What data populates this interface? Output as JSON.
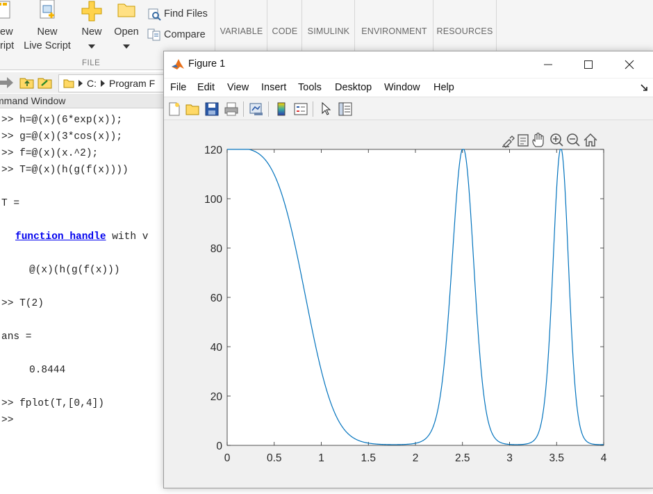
{
  "toolstrip": {
    "new_label_partial": [
      "ew",
      "ript"
    ],
    "new_live_script": [
      "New",
      "Live Script"
    ],
    "new": "New",
    "open": "Open",
    "find_files": "Find Files",
    "compare": "Compare",
    "section_file": "FILE",
    "tabs": [
      "VARIABLE",
      "CODE",
      "SIMULINK",
      "ENVIRONMENT",
      "RESOURCES"
    ]
  },
  "address": {
    "drive": "C:",
    "folder": "Program F"
  },
  "command_window": {
    "title": "mmand Window",
    "lines": [
      ">> h=@(x)(6*exp(x));",
      ">> g=@(x)(3*cos(x));",
      ">> f=@(x)(x.^2);",
      ">> T=@(x)(h(g(f(x))))",
      "T =",
      "function_handle",
      " with v",
      "@(x)(h(g(f(x)))",
      ">> T(2)",
      "ans =",
      "0.8444",
      ">> fplot(T,[0,4])",
      ">>"
    ]
  },
  "figure": {
    "title": "Figure 1",
    "menus": [
      "File",
      "Edit",
      "View",
      "Insert",
      "Tools",
      "Desktop",
      "Window",
      "Help"
    ],
    "toolbar_icons": [
      "new-figure-icon",
      "open-file-icon",
      "save-icon",
      "print-icon",
      "link-plot-icon",
      "colorbar-icon",
      "legend-icon",
      "pointer-icon",
      "property-inspector-icon"
    ],
    "axes_toolbar_icons": [
      "brush-icon",
      "datatip-icon",
      "pan-icon",
      "zoom-in-icon",
      "zoom-out-icon",
      "home-icon"
    ]
  },
  "chart_data": {
    "type": "line",
    "expression": "6*exp(3*cos(x.^2))",
    "xlim": [
      0,
      4
    ],
    "ylim": [
      0,
      120
    ],
    "xticks": [
      "0",
      "0.5",
      "1",
      "1.5",
      "2",
      "2.5",
      "3",
      "3.5",
      "4"
    ],
    "yticks": [
      "0",
      "20",
      "40",
      "60",
      "80",
      "100",
      "120"
    ],
    "line_color": "#0072BD",
    "grid": false,
    "series": [
      {
        "x": [
          0,
          0.25,
          0.5,
          0.75,
          1.0,
          1.25,
          1.5,
          1.75,
          2.0,
          2.25,
          2.4,
          2.5066,
          2.6,
          2.75,
          3.0,
          3.25,
          3.4,
          3.545,
          3.7,
          3.85,
          4.0
        ],
        "y": [
          120.5,
          118.4,
          93.3,
          47.4,
          15.1,
          3.55,
          0.76,
          0.33,
          0.86,
          6.4,
          63.6,
          120.5,
          72.0,
          6.9,
          0.31,
          2.2,
          68.8,
          120.5,
          37.1,
          1.6,
          0.42
        ]
      }
    ]
  }
}
